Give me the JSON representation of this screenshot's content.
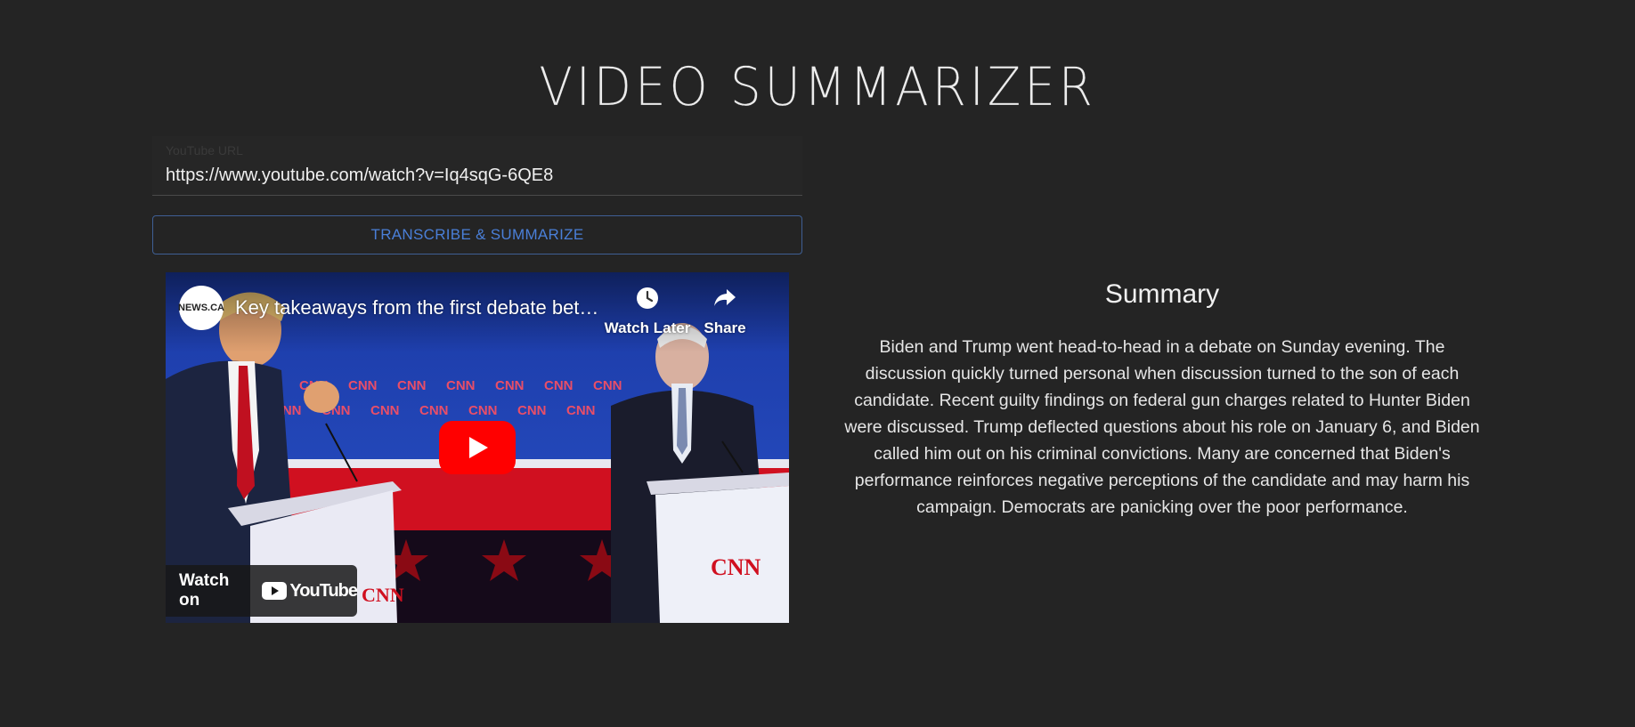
{
  "app": {
    "title": "VIDEO SUMMARIZER"
  },
  "url_field": {
    "label": "YouTube URL",
    "value": "https://www.youtube.com/watch?v=Iq4sqG-6QE8"
  },
  "actions": {
    "submit_label": "TRANSCRIBE & SUMMARIZE"
  },
  "video": {
    "channel_logo_text": "NEWS.CA",
    "title": "Key takeaways from the first debate between Biden and Trump",
    "watch_later_label": "Watch Later",
    "share_label": "Share",
    "watch_on_label": "Watch on",
    "youtube_logo_text": "YouTube",
    "backdrop_text": "CNN",
    "podium_text": "CNN",
    "play_button_color": "#ff0000"
  },
  "summary": {
    "heading": "Summary",
    "text": "Biden and Trump went head-to-head in a debate on Sunday evening. The discussion quickly turned personal when discussion turned to the son of each candidate. Recent guilty findings on federal gun charges related to Hunter Biden were discussed. Trump deflected questions about his role on January 6, and Biden called him out on his criminal convictions. Many are concerned that Biden's performance reinforces negative perceptions of the candidate and may harm his campaign. Democrats are panicking over the poor performance."
  },
  "colors": {
    "background": "#242424",
    "accent": "#4a7fd8",
    "text": "#e8e8e8"
  }
}
